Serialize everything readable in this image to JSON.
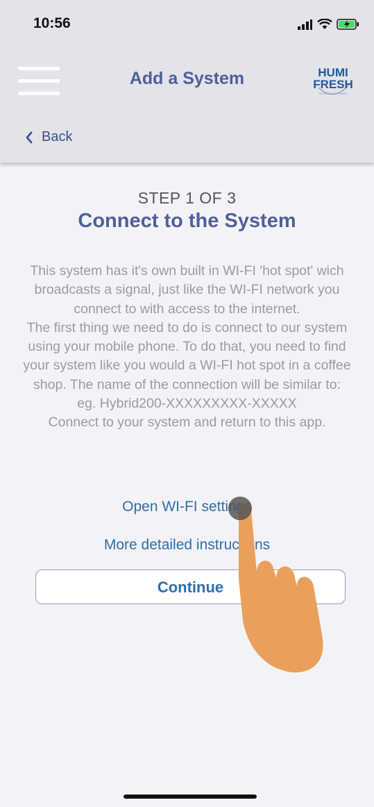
{
  "status_bar": {
    "time": "10:56"
  },
  "header": {
    "title": "Add a System",
    "logo_text_top": "HUMI",
    "logo_text_bottom": "FRESH",
    "logo_tagline": "VENTILATIONS"
  },
  "nav": {
    "back_label": "Back"
  },
  "step": {
    "label": "STEP 1 OF 3",
    "title": "Connect to the System"
  },
  "instructions": {
    "paragraph1": "This system has it's own built in WI-FI 'hot spot' wich broadcasts a signal, just like the WI-FI network you connect to with access to the internet.",
    "paragraph2": "The first thing we need to do is connect to our system using your mobile phone. To do that, you need to find your system like you would a WI-FI hot spot in a coffee shop. The name of the connection will be similar to:",
    "example": "eg. Hybrid200-XXXXXXXXX-XXXXX",
    "closing": "Connect to your system and return to this app."
  },
  "actions": {
    "open_wifi_label": "Open WI-FI settings",
    "detailed_instructions_label": "More detailed instructions",
    "continue_label": "Continue"
  },
  "colors": {
    "accent": "#4f5f99",
    "link": "#2c6fab",
    "header_bg": "#e3e3ea",
    "page_bg": "#f3f3f7",
    "hand": "#e9a05c"
  }
}
